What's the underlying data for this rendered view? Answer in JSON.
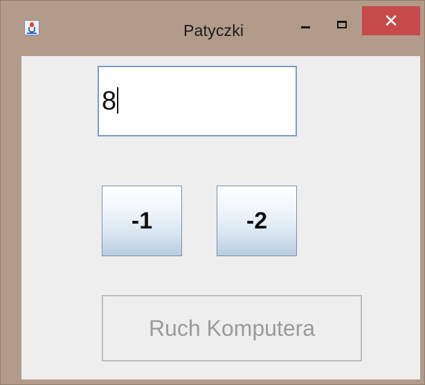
{
  "window": {
    "title": "Patyczki",
    "app_icon": "java-cup-icon",
    "controls": {
      "minimize_icon": "minimize-icon",
      "maximize_icon": "maximize-icon",
      "close_label": "✕"
    },
    "colors": {
      "frame": "#b29b8a",
      "close_button": "#c74a4a",
      "client_background": "#eeeeee"
    }
  },
  "main": {
    "stick_count_field": {
      "value": "8"
    },
    "buttons": {
      "minus_one_label": "-1",
      "minus_two_label": "-2",
      "computer_move_label": "Ruch Komputera",
      "computer_move_enabled": false
    }
  }
}
